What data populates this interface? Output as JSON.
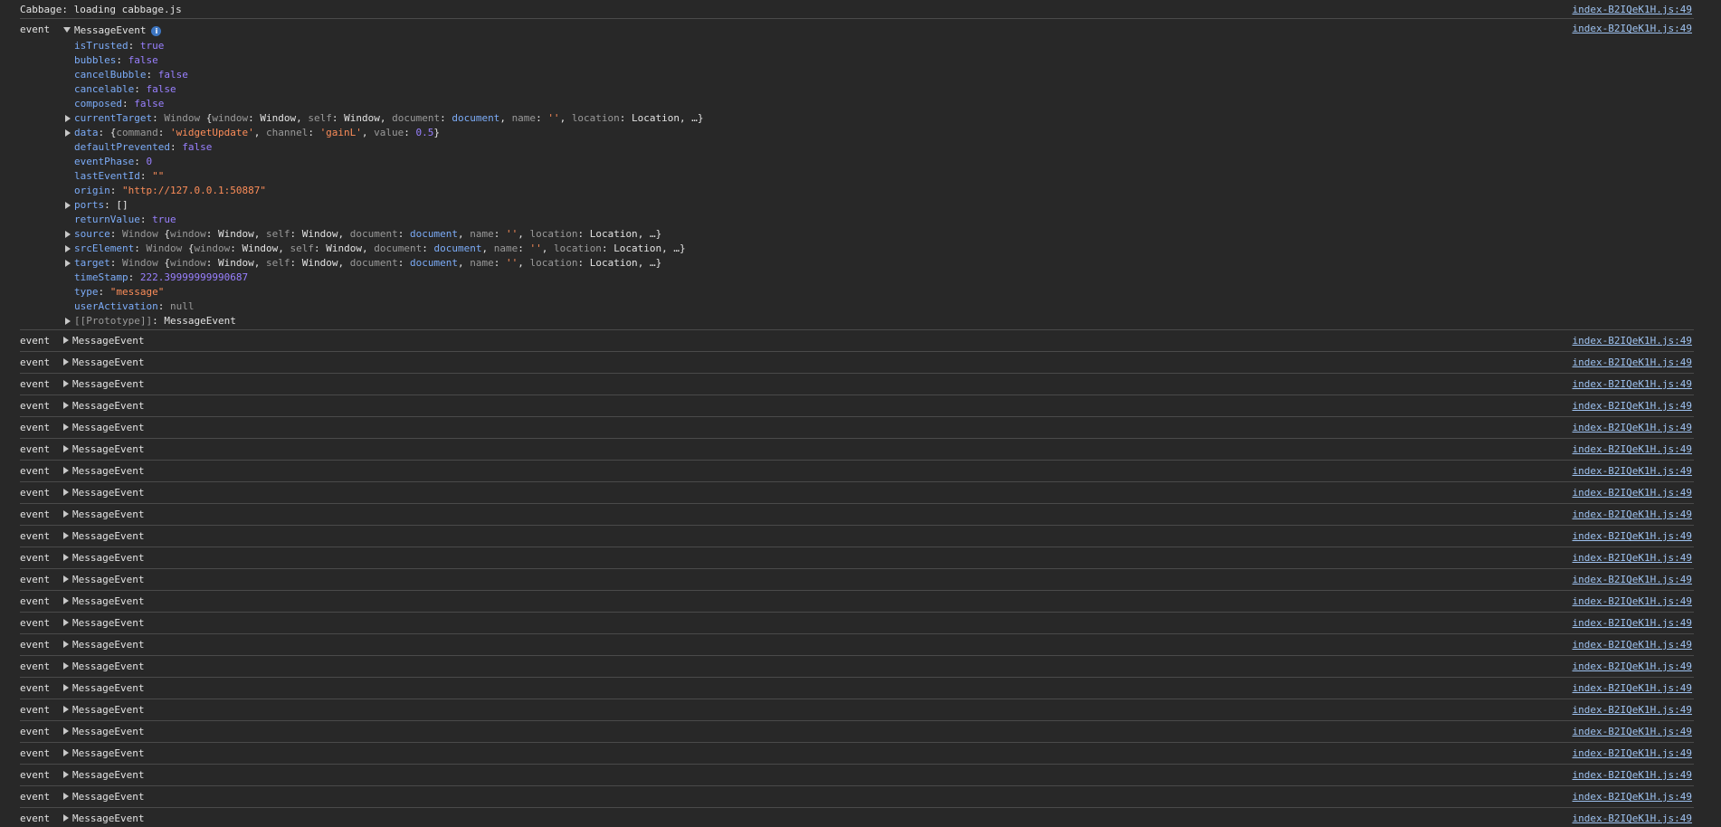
{
  "source_link": "index-B2IQeK1H.js:49",
  "first_message": "Cabbage: loading cabbage.js",
  "event_label": "event",
  "event_class": "MessageEvent",
  "info_icon": "i",
  "props": {
    "isTrusted": {
      "key": "isTrusted",
      "value": "true"
    },
    "bubbles": {
      "key": "bubbles",
      "value": "false"
    },
    "cancelBubble": {
      "key": "cancelBubble",
      "value": "false"
    },
    "cancelable": {
      "key": "cancelable",
      "value": "false"
    },
    "composed": {
      "key": "composed",
      "value": "false"
    },
    "currentTarget": {
      "key": "currentTarget",
      "cls": "Window",
      "window_k": "window",
      "window_v": "Window",
      "self_k": "self",
      "self_v": "Window",
      "document_k": "document",
      "document_v": "document",
      "name_k": "name",
      "name_v": "''",
      "location_k": "location",
      "location_v": "Location",
      "ellipsis": "…"
    },
    "data": {
      "key": "data",
      "command_k": "command",
      "command_v": "'widgetUpdate'",
      "channel_k": "channel",
      "channel_v": "'gainL'",
      "value_k": "value",
      "value_v": "0.5"
    },
    "defaultPrevented": {
      "key": "defaultPrevented",
      "value": "false"
    },
    "eventPhase": {
      "key": "eventPhase",
      "value": "0"
    },
    "lastEventId": {
      "key": "lastEventId",
      "value": "\"\""
    },
    "origin": {
      "key": "origin",
      "value": "\"http://127.0.0.1:50887\""
    },
    "ports": {
      "key": "ports",
      "value": "[]"
    },
    "returnValue": {
      "key": "returnValue",
      "value": "true"
    },
    "source": {
      "key": "source",
      "cls": "Window"
    },
    "srcElement": {
      "key": "srcElement",
      "cls": "Window"
    },
    "target": {
      "key": "target",
      "cls": "Window"
    },
    "timeStamp": {
      "key": "timeStamp",
      "value": "222.39999999990687"
    },
    "type": {
      "key": "type",
      "value": "\"message\""
    },
    "userActivation": {
      "key": "userActivation",
      "value": "null"
    },
    "prototype": {
      "key": "[[Prototype]]",
      "value": "MessageEvent"
    }
  },
  "collapsed_rows": 23
}
